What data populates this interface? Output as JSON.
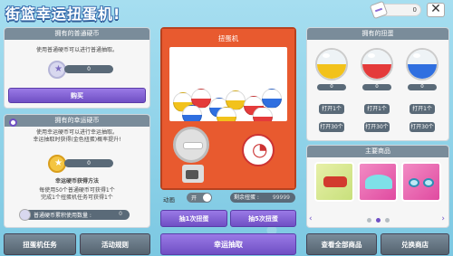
{
  "title": "街篮幸运扭蛋机!",
  "topbar": {
    "ticket_value": "0"
  },
  "normal_coin": {
    "heading": "拥有的普通硬币",
    "desc": "使用普通硬币可以进行普通抽取。",
    "count": "0",
    "buy_label": "购买"
  },
  "lucky_coin": {
    "heading": "拥有的幸运硬币",
    "desc_1": "使用幸运硬币可以进行幸运抽取。",
    "desc_2": "幸运抽取时获得(金色扭蛋)概率提升!",
    "count": "0",
    "method_title": "幸运硬币获得方法",
    "method_1": "每使用50个普通硬币可获得1个",
    "method_2": "完成1个扭蛋机任务可获得1个",
    "used_label": "普通硬币累积使用数量 :",
    "used_value": "0"
  },
  "machine": {
    "label": "扭蛋机",
    "anim_label": "动画",
    "toggle_label": "开",
    "remain_label": "剩余扭蛋 :",
    "remain_value": "99999",
    "draw1_label": "抽1次扭蛋",
    "draw5_label": "抽5次扭蛋",
    "lucky_draw_label": "幸运抽取"
  },
  "capsules": {
    "heading": "拥有的扭蛋",
    "items": [
      {
        "color": "#f2c21b",
        "count": "0",
        "open1": "打开1个",
        "open30": "打开30个"
      },
      {
        "color": "#e43b3b",
        "count": "0",
        "open1": "打开1个",
        "open30": "打开30个"
      },
      {
        "color": "#2f6fe0",
        "count": "0",
        "open1": "打开1个",
        "open30": "打开30个"
      }
    ]
  },
  "featured": {
    "heading": "主要商品"
  },
  "bottom": {
    "mission": "扭蛋机任务",
    "rules": "活动规则",
    "view_all": "查看全部商品",
    "exchange": "兑换商店"
  }
}
